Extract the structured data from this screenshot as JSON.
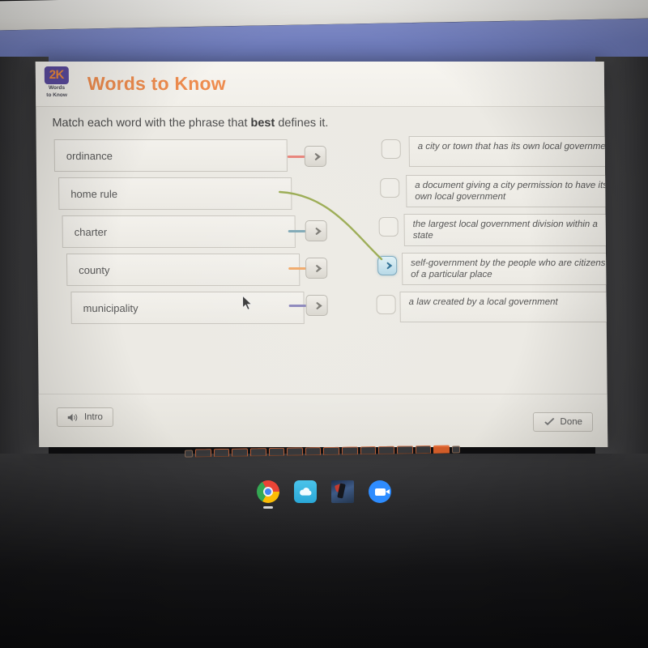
{
  "app": {
    "title": "Words to Know",
    "logo_mark": "2K",
    "logo_sub_line1": "Words",
    "logo_sub_line2": "to Know",
    "instruction_prefix": "Match each word with the phrase that ",
    "instruction_emphasis": "best",
    "instruction_suffix": " defines it.",
    "accent_color": "#ee8c4e",
    "logo_bg_color": "#5b4b9e",
    "header_bar_color": "#6f7cbb"
  },
  "words": [
    {
      "label": "ordinance",
      "stub_color": "#e8837a",
      "arrow_icon": "arrow-right-icon"
    },
    {
      "label": "home rule",
      "stub_color": "#9aab52",
      "arrow_icon": "arrow-right-icon"
    },
    {
      "label": "charter",
      "stub_color": "#7fa8b5",
      "arrow_icon": "arrow-right-icon"
    },
    {
      "label": "county",
      "stub_color": "#f0a868",
      "arrow_icon": "arrow-right-icon"
    },
    {
      "label": "municipality",
      "stub_color": "#8b86bb",
      "arrow_icon": "arrow-right-icon"
    }
  ],
  "definitions": [
    {
      "text": "a city or town that has its own local government",
      "selected": false
    },
    {
      "text": "a document giving a city permission to have its own local government",
      "selected": false
    },
    {
      "text": "the largest local government division within a state",
      "selected": false
    },
    {
      "text": "self-government by the people who are citizens of a particular place",
      "selected": true
    },
    {
      "text": "a law created by a local government",
      "selected": false
    }
  ],
  "connection": {
    "from_word": "home rule",
    "to_definition": "self-government by the people who are citizens of a particular place",
    "line_color": "#9aab52"
  },
  "footer": {
    "intro_label": "Intro",
    "intro_icon": "speaker-icon",
    "done_label": "Done",
    "done_icon": "checkmark-icon"
  },
  "pagination": {
    "segments": 15,
    "current_index": 13
  },
  "taskbar": {
    "items": [
      {
        "name": "chrome-icon"
      },
      {
        "name": "cloud-storage-icon"
      },
      {
        "name": "photo-thumbnail-icon"
      },
      {
        "name": "zoom-icon"
      }
    ]
  }
}
